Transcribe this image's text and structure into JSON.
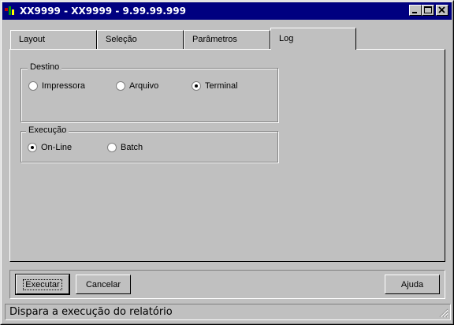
{
  "window": {
    "title": "XX9999 - XX9999 - 9.99.99.999"
  },
  "title_buttons": [
    "minimize-icon",
    "maximize-icon",
    "close-icon"
  ],
  "tabs": [
    {
      "label": "Layout",
      "active": false
    },
    {
      "label": "Seleção",
      "active": false
    },
    {
      "label": "Parâmetros",
      "active": false
    },
    {
      "label": "Log",
      "active": true
    }
  ],
  "destino": {
    "title": "Destino",
    "options": [
      {
        "label": "Impressora",
        "checked": false
      },
      {
        "label": "Arquivo",
        "checked": false
      },
      {
        "label": "Terminal",
        "checked": true
      }
    ]
  },
  "execucao": {
    "title": "Execução",
    "options": [
      {
        "label": "On-Line",
        "checked": true
      },
      {
        "label": "Batch",
        "checked": false
      }
    ]
  },
  "buttons": {
    "executar": "Executar",
    "cancelar": "Cancelar",
    "ajuda": "Ajuda"
  },
  "statusbar": {
    "text": "Dispara a execução do relatório"
  },
  "colors": {
    "titlebar": "#000080",
    "face": "#c0c0c0"
  }
}
